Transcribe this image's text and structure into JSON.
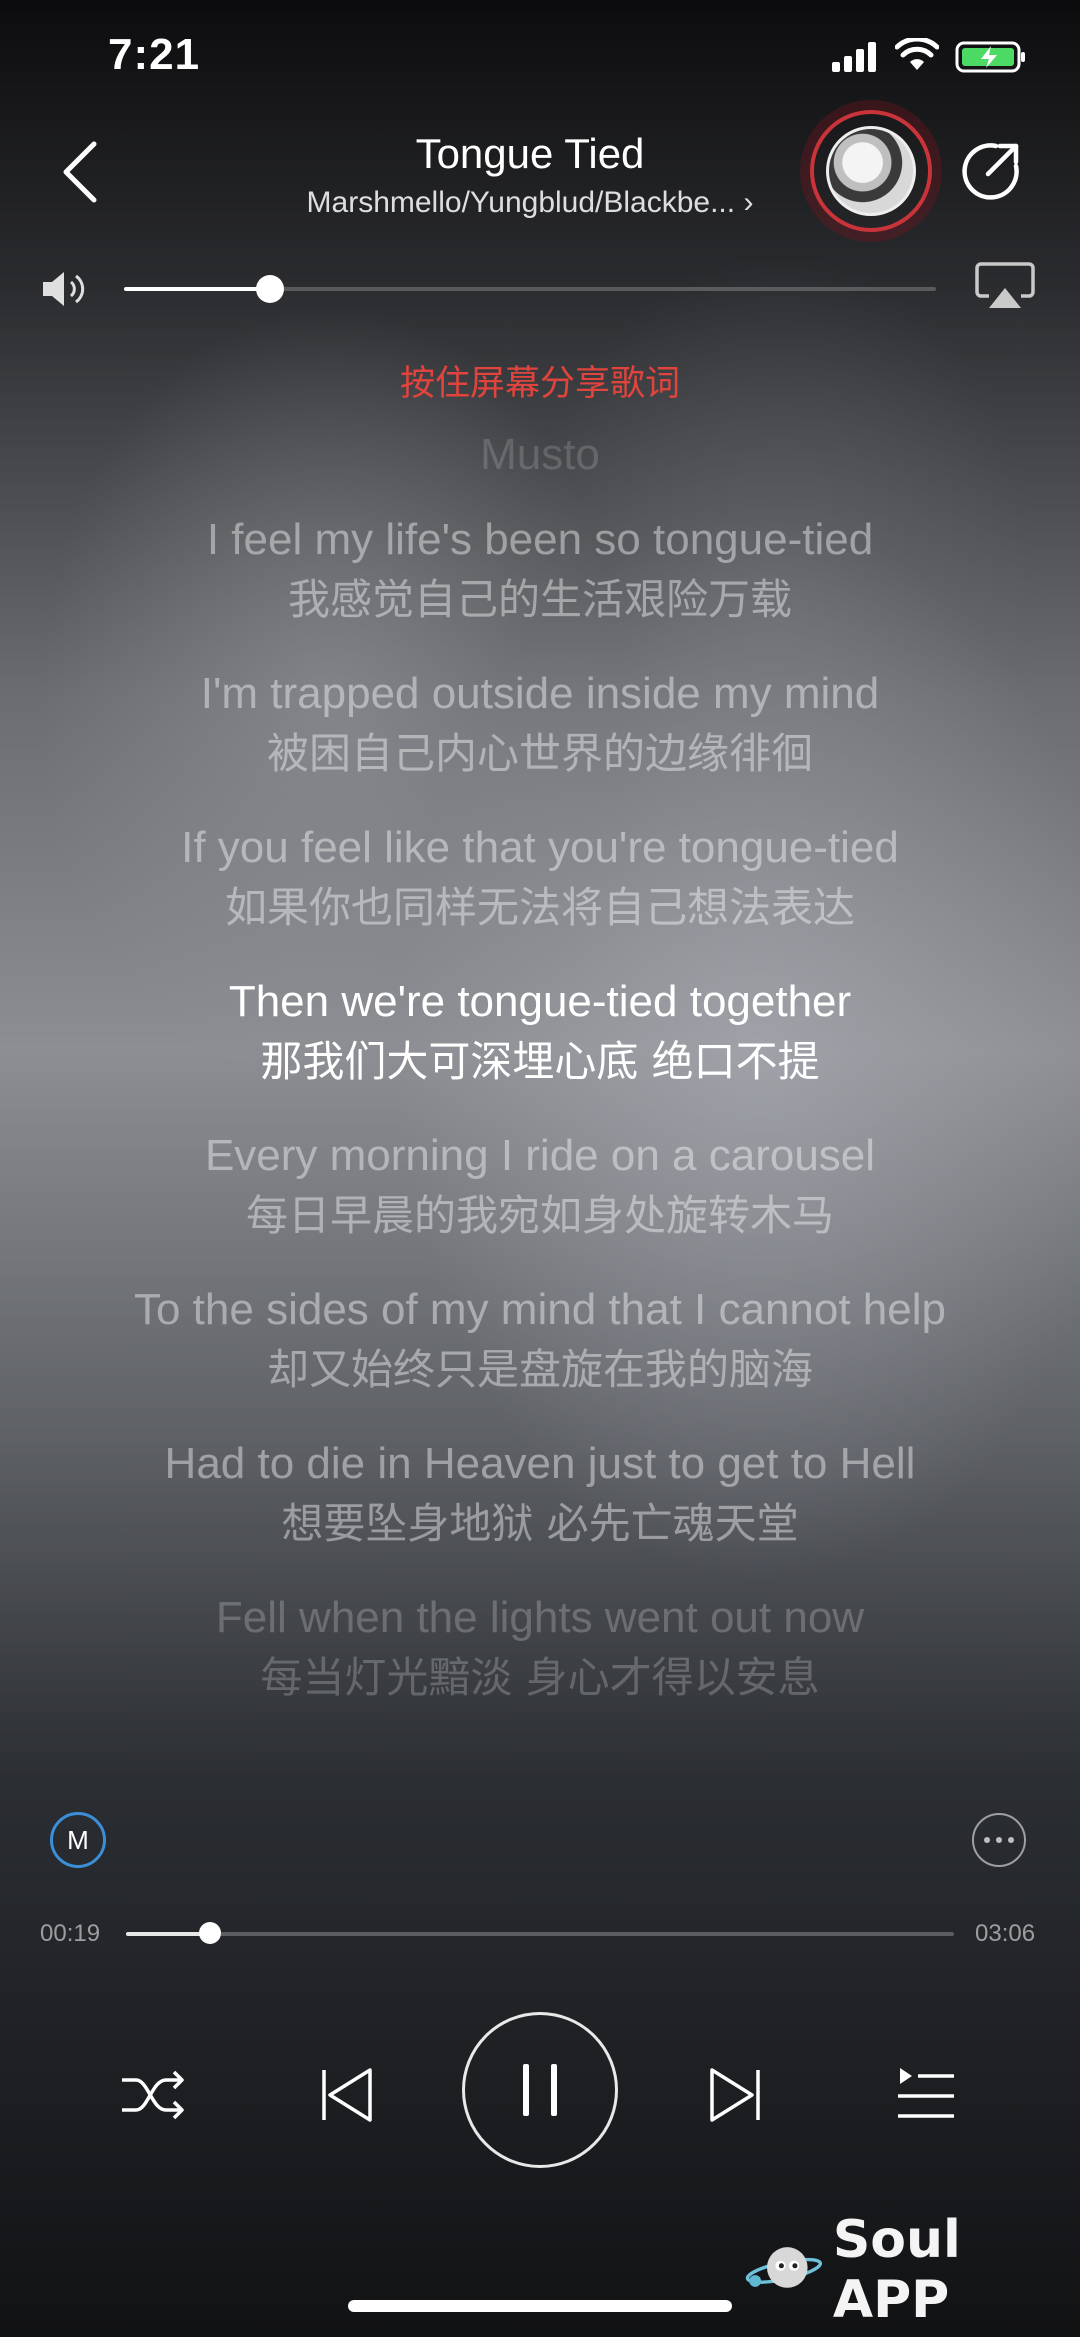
{
  "status_bar": {
    "time": "7:21"
  },
  "header": {
    "title": "Tongue Tied",
    "artist": "Marshmello/Yungblud/Blackbe...",
    "artist_chevron": "›"
  },
  "volume": {
    "level": 0.18
  },
  "hint": "按住屏幕分享歌词",
  "lyrics": {
    "previous": "Musto",
    "lines": [
      {
        "en": "I feel my life's been so tongue-tied",
        "cn": "我感觉自己的生活艰险万载",
        "state": "normal"
      },
      {
        "en": "I'm trapped outside inside my mind",
        "cn": "被困自己内心世界的边缘徘徊",
        "state": "normal"
      },
      {
        "en": "If you feel like that you're tongue-tied",
        "cn": "如果你也同样无法将自己想法表达",
        "state": "normal"
      },
      {
        "en": "Then we're tongue-tied together",
        "cn": "那我们大可深埋心底 绝口不提",
        "state": "active"
      },
      {
        "en": "Every morning I ride on a carousel",
        "cn": "每日早晨的我宛如身处旋转木马",
        "state": "normal"
      },
      {
        "en": "To the sides of my mind that I cannot help",
        "cn": "却又始终只是盘旋在我的脑海",
        "state": "normal"
      },
      {
        "en": "Had to die in Heaven just to get to Hell",
        "cn": "想要坠身地狱 必先亡魂天堂",
        "state": "normal"
      },
      {
        "en": "Fell when the lights went out now",
        "cn": "每当灯光黯淡 身心才得以安息",
        "state": "fade"
      }
    ]
  },
  "player": {
    "badge": "M",
    "elapsed": "00:19",
    "total": "03:06",
    "progress": 0.102
  },
  "watermark": {
    "text": "Soul APP"
  },
  "icons": {
    "back": "chevron-left-icon",
    "share": "share-icon",
    "volume": "speaker-icon",
    "airplay": "airplay-icon",
    "more": "more-icon",
    "shuffle": "shuffle-icon",
    "prev": "previous-icon",
    "play": "pause-icon",
    "next": "next-icon",
    "playlist": "playlist-icon"
  }
}
